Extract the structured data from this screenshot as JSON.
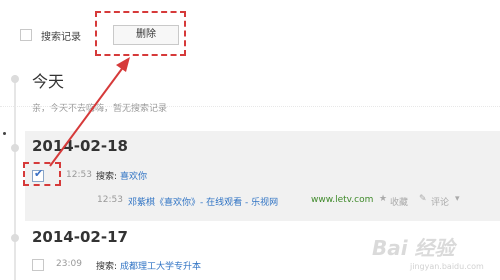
{
  "toolbar": {
    "search_records_label": "搜索记录",
    "delete_label": "删除"
  },
  "today": {
    "title": "今天",
    "empty_message": "亲，今天不去嗨嗨，暂无搜索记录"
  },
  "days": [
    {
      "date": "2014-02-18",
      "entries": [
        {
          "time": "12:53",
          "label": "搜索:",
          "query": "喜欢你",
          "checked": true
        },
        {
          "time": "12:53",
          "title": "邓紫棋《喜欢你》- 在线观看 - 乐视网",
          "url": "www.letv.com",
          "favorite": "收藏",
          "comment": "评论"
        }
      ]
    },
    {
      "date": "2014-02-17",
      "entries": [
        {
          "time": "23:09",
          "label": "搜索:",
          "query": "成都理工大学专升本",
          "checked": false
        }
      ]
    }
  ],
  "watermark": {
    "text": "Bai 经验",
    "sub": "jingyan.baidu.com"
  },
  "colors": {
    "annotation": "#d63a3a",
    "link": "#2f73c4",
    "url": "#3f8a2a"
  },
  "icons": {
    "favorite": "star-icon",
    "comment": "comment-icon",
    "more": "chevron-down-icon",
    "check": "check-icon"
  }
}
